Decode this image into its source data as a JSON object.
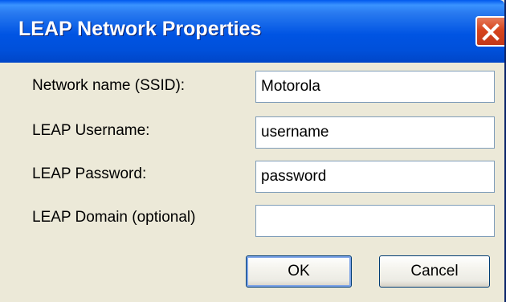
{
  "dialog": {
    "title": "LEAP Network Properties",
    "close_icon": "close-icon"
  },
  "form": {
    "ssid": {
      "label": "Network name (SSID):",
      "value": "Motorola"
    },
    "username": {
      "label": "LEAP Username:",
      "value": "username"
    },
    "password": {
      "label": "LEAP Password:",
      "value": "password"
    },
    "domain": {
      "label": "LEAP Domain (optional)",
      "value": ""
    }
  },
  "buttons": {
    "ok_label": "OK",
    "cancel_label": "Cancel"
  },
  "colors": {
    "titlebar": "#0054E3",
    "dialog_bg": "#ECE9D8",
    "close_button": "#D6451E",
    "field_border": "#7F9DB9"
  }
}
